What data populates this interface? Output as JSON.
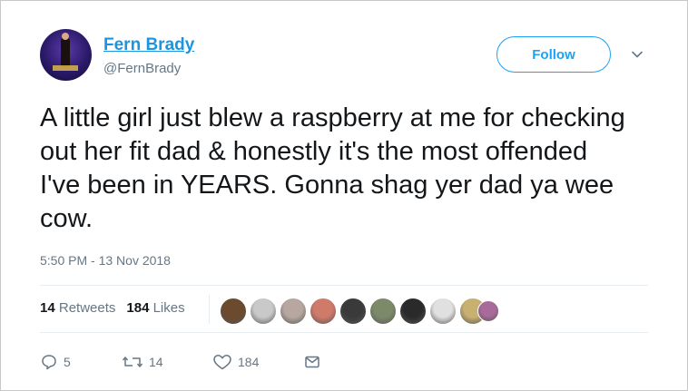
{
  "tweet": {
    "author_name": "Fern Brady",
    "author_handle": "@FernBrady",
    "follow_label": "Follow",
    "text": "A little girl just blew a raspberry at me for checking out her fit dad & honestly it's the most offended I've been in YEARS. Gonna shag yer dad ya wee cow.",
    "timestamp": "5:50 PM - 13 Nov 2018",
    "retweets_count": "14",
    "retweets_label": "Retweets",
    "likes_count": "184",
    "likes_label": "Likes"
  },
  "actions": {
    "reply_count": "5",
    "retweet_count": "14",
    "like_count": "184"
  },
  "icons": {
    "reply": "reply-icon",
    "retweet": "retweet-icon",
    "like": "heart-icon",
    "dm": "message-icon",
    "more": "chevron-down-icon"
  },
  "colors": {
    "accent": "#1da1f2",
    "name_link": "#1b95e0",
    "muted": "#657786",
    "text": "#14171a",
    "likers": [
      "#6b4a2e",
      "#c9c9c9",
      "#b8a7a0",
      "#d07a6a",
      "#3a3a3a",
      "#7c8a6a",
      "#2a2a2a",
      "#e0e0e0",
      "#c8b070",
      "#a86a9a"
    ]
  }
}
